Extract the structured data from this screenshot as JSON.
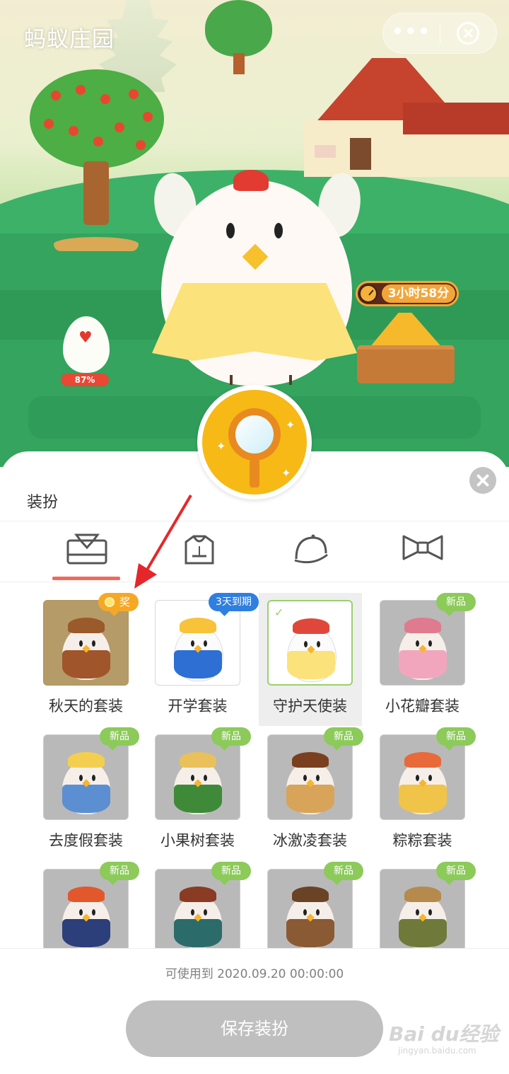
{
  "app": {
    "title": "蚂蚁庄园",
    "more_label": "•••"
  },
  "scene": {
    "egg_percent": "87%",
    "timer_text": "3小时58分"
  },
  "panel": {
    "title": "装扮",
    "categories": [
      {
        "name": "outfit-tab",
        "icon": "clothes-icon",
        "active": true
      },
      {
        "name": "hoodie-tab",
        "icon": "hoodie-icon",
        "active": false
      },
      {
        "name": "hat-tab",
        "icon": "hat-icon",
        "active": false
      },
      {
        "name": "bow-tab",
        "icon": "bow-tie-icon",
        "active": false
      }
    ],
    "items": [
      {
        "label": "秋天的套装",
        "badge": "奖",
        "badge_type": "prize"
      },
      {
        "label": "开学套装",
        "badge": "3天到期",
        "badge_type": "expiry"
      },
      {
        "label": "守护天使装",
        "badge": "",
        "badge_type": "selected"
      },
      {
        "label": "小花瓣套装",
        "badge": "新品",
        "badge_type": "new"
      },
      {
        "label": "去度假套装",
        "badge": "新品",
        "badge_type": "new"
      },
      {
        "label": "小果树套装",
        "badge": "新品",
        "badge_type": "new"
      },
      {
        "label": "冰激凌套装",
        "badge": "新品",
        "badge_type": "new"
      },
      {
        "label": "粽粽套装",
        "badge": "新品",
        "badge_type": "new"
      },
      {
        "label": "",
        "badge": "新品",
        "badge_type": "new"
      },
      {
        "label": "",
        "badge": "新品",
        "badge_type": "new"
      },
      {
        "label": "",
        "badge": "新品",
        "badge_type": "new"
      },
      {
        "label": "",
        "badge": "新品",
        "badge_type": "new"
      }
    ],
    "valid_until": "可使用到 2020.09.20 00:00:00",
    "save_label": "保存装扮"
  },
  "watermark": {
    "brand": "Bai du经验",
    "url": "jingyan.baidu.com"
  },
  "colors": {
    "accent_red": "#ee6a5d",
    "new_badge": "#8cca5a",
    "expiry_badge": "#2f7fe0",
    "prize_badge": "#f6a825",
    "save_disabled": "#bfbfbf"
  }
}
